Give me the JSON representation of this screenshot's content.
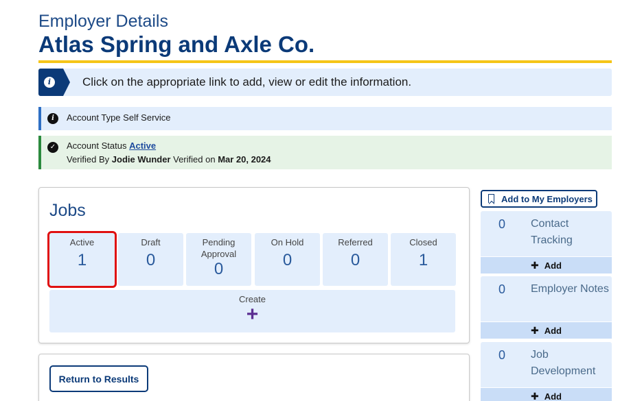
{
  "header": {
    "subtitle": "Employer Details",
    "title": "Atlas Spring and Axle Co."
  },
  "info_banner": {
    "icon": "info-icon",
    "text": "Click on the appropriate link to add, view or edit the information."
  },
  "account_type": {
    "label": "Account Type",
    "value": "Self Service"
  },
  "account_status": {
    "label": "Account Status",
    "value": "Active",
    "verified_by_label": "Verified By",
    "verified_by": "Jodie Wunder",
    "verified_on_label": "Verified on",
    "verified_on": "Mar 20, 2024"
  },
  "jobs": {
    "title": "Jobs",
    "tiles": [
      {
        "label": "Active",
        "count": "1"
      },
      {
        "label": "Draft",
        "count": "0"
      },
      {
        "label": "Pending Approval",
        "count": "0"
      },
      {
        "label": "On Hold",
        "count": "0"
      },
      {
        "label": "Referred",
        "count": "0"
      },
      {
        "label": "Closed",
        "count": "1"
      }
    ],
    "create_label": "Create",
    "create_icon": "plus-icon"
  },
  "results": {
    "return_label": "Return to Results"
  },
  "sidebar": {
    "add_to_my_employers": "Add to My Employers",
    "cards": [
      {
        "count": "0",
        "title": "Contact Tracking",
        "add_label": "Add"
      },
      {
        "count": "0",
        "title": "Employer Notes",
        "add_label": "Add"
      },
      {
        "count": "0",
        "title": "Job Development",
        "add_label": "Add"
      }
    ]
  },
  "colors": {
    "primary": "#0b3a78",
    "accent_rule": "#f5c518",
    "tile_bg": "#e3eefc",
    "success": "#2b8a3e",
    "highlight": "#e01010"
  }
}
